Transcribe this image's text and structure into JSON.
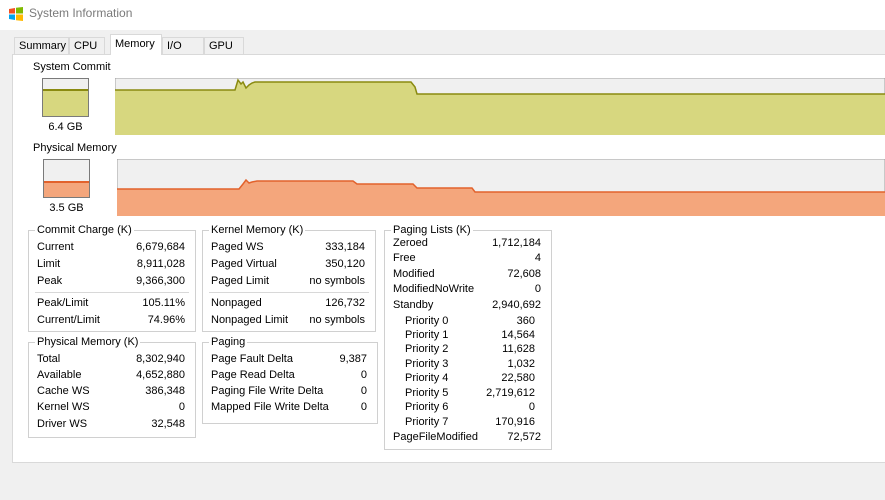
{
  "window": {
    "title": "System Information"
  },
  "tabs": [
    {
      "label": "Summary"
    },
    {
      "label": "CPU"
    },
    {
      "label": "Memory",
      "active": true
    },
    {
      "label": "I/O"
    },
    {
      "label": "GPU"
    }
  ],
  "system_commit": {
    "label": "System Commit",
    "value": "6.4 GB",
    "level": 0.72,
    "color": "#d7d77f",
    "line": "#8a8a10"
  },
  "physical_memory_graph": {
    "label": "Physical Memory",
    "value": "3.5 GB",
    "level": 0.42,
    "color": "#f4a67c",
    "line": "#e2622c"
  },
  "commit_charge": {
    "title": "Commit Charge (K)",
    "rows": [
      {
        "k": "Current",
        "v": "6,679,684"
      },
      {
        "k": "Limit",
        "v": "8,911,028"
      },
      {
        "k": "Peak",
        "v": "9,366,300"
      },
      {
        "k": "Peak/Limit",
        "v": "105.11%"
      },
      {
        "k": "Current/Limit",
        "v": "74.96%"
      }
    ]
  },
  "kernel_memory": {
    "title": "Kernel Memory (K)",
    "rows": [
      {
        "k": "Paged WS",
        "v": "333,184"
      },
      {
        "k": "Paged Virtual",
        "v": "350,120"
      },
      {
        "k": "Paged Limit",
        "v": "no symbols"
      },
      {
        "k": "Nonpaged",
        "v": "126,732"
      },
      {
        "k": "Nonpaged Limit",
        "v": "no symbols"
      }
    ]
  },
  "paging_lists": {
    "title": "Paging Lists (K)",
    "rows": [
      {
        "k": "Zeroed",
        "v": "1,712,184"
      },
      {
        "k": "Free",
        "v": "4"
      },
      {
        "k": "Modified",
        "v": "72,608"
      },
      {
        "k": "ModifiedNoWrite",
        "v": "0"
      },
      {
        "k": "Standby",
        "v": "2,940,692"
      },
      {
        "k": "Priority 0",
        "v": "360"
      },
      {
        "k": "Priority 1",
        "v": "14,564"
      },
      {
        "k": "Priority 2",
        "v": "11,628"
      },
      {
        "k": "Priority 3",
        "v": "1,032"
      },
      {
        "k": "Priority 4",
        "v": "22,580"
      },
      {
        "k": "Priority 5",
        "v": "2,719,612"
      },
      {
        "k": "Priority 6",
        "v": "0"
      },
      {
        "k": "Priority 7",
        "v": "170,916"
      },
      {
        "k": "PageFileModified",
        "v": "72,572"
      }
    ]
  },
  "physical_memory": {
    "title": "Physical Memory (K)",
    "rows": [
      {
        "k": "Total",
        "v": "8,302,940"
      },
      {
        "k": "Available",
        "v": "4,652,880"
      },
      {
        "k": "Cache WS",
        "v": "386,348"
      },
      {
        "k": "Kernel WS",
        "v": "0"
      },
      {
        "k": "Driver WS",
        "v": "32,548"
      }
    ]
  },
  "paging": {
    "title": "Paging",
    "rows": [
      {
        "k": "Page Fault Delta",
        "v": "9,387"
      },
      {
        "k": "Page Read Delta",
        "v": "0"
      },
      {
        "k": "Paging File Write Delta",
        "v": "0"
      },
      {
        "k": "Mapped File Write Delta",
        "v": "0"
      }
    ]
  }
}
